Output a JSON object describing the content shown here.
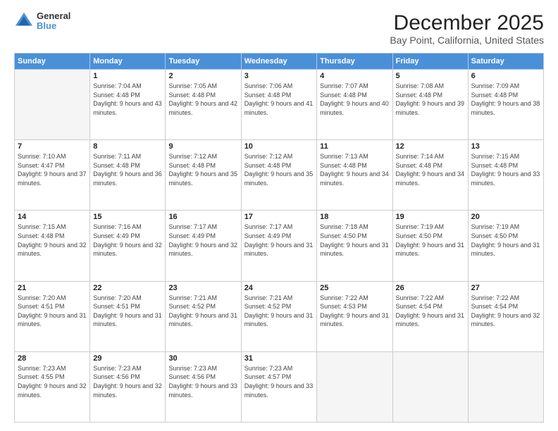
{
  "logo": {
    "general": "General",
    "blue": "Blue"
  },
  "header": {
    "title": "December 2025",
    "subtitle": "Bay Point, California, United States"
  },
  "calendar": {
    "weekdays": [
      "Sunday",
      "Monday",
      "Tuesday",
      "Wednesday",
      "Thursday",
      "Friday",
      "Saturday"
    ],
    "weeks": [
      [
        {
          "day": "",
          "empty": true
        },
        {
          "day": "1",
          "sunrise": "Sunrise: 7:04 AM",
          "sunset": "Sunset: 4:48 PM",
          "daylight": "Daylight: 9 hours and 43 minutes."
        },
        {
          "day": "2",
          "sunrise": "Sunrise: 7:05 AM",
          "sunset": "Sunset: 4:48 PM",
          "daylight": "Daylight: 9 hours and 42 minutes."
        },
        {
          "day": "3",
          "sunrise": "Sunrise: 7:06 AM",
          "sunset": "Sunset: 4:48 PM",
          "daylight": "Daylight: 9 hours and 41 minutes."
        },
        {
          "day": "4",
          "sunrise": "Sunrise: 7:07 AM",
          "sunset": "Sunset: 4:48 PM",
          "daylight": "Daylight: 9 hours and 40 minutes."
        },
        {
          "day": "5",
          "sunrise": "Sunrise: 7:08 AM",
          "sunset": "Sunset: 4:48 PM",
          "daylight": "Daylight: 9 hours and 39 minutes."
        },
        {
          "day": "6",
          "sunrise": "Sunrise: 7:09 AM",
          "sunset": "Sunset: 4:48 PM",
          "daylight": "Daylight: 9 hours and 38 minutes."
        }
      ],
      [
        {
          "day": "7",
          "sunrise": "Sunrise: 7:10 AM",
          "sunset": "Sunset: 4:47 PM",
          "daylight": "Daylight: 9 hours and 37 minutes."
        },
        {
          "day": "8",
          "sunrise": "Sunrise: 7:11 AM",
          "sunset": "Sunset: 4:48 PM",
          "daylight": "Daylight: 9 hours and 36 minutes."
        },
        {
          "day": "9",
          "sunrise": "Sunrise: 7:12 AM",
          "sunset": "Sunset: 4:48 PM",
          "daylight": "Daylight: 9 hours and 35 minutes."
        },
        {
          "day": "10",
          "sunrise": "Sunrise: 7:12 AM",
          "sunset": "Sunset: 4:48 PM",
          "daylight": "Daylight: 9 hours and 35 minutes."
        },
        {
          "day": "11",
          "sunrise": "Sunrise: 7:13 AM",
          "sunset": "Sunset: 4:48 PM",
          "daylight": "Daylight: 9 hours and 34 minutes."
        },
        {
          "day": "12",
          "sunrise": "Sunrise: 7:14 AM",
          "sunset": "Sunset: 4:48 PM",
          "daylight": "Daylight: 9 hours and 34 minutes."
        },
        {
          "day": "13",
          "sunrise": "Sunrise: 7:15 AM",
          "sunset": "Sunset: 4:48 PM",
          "daylight": "Daylight: 9 hours and 33 minutes."
        }
      ],
      [
        {
          "day": "14",
          "sunrise": "Sunrise: 7:15 AM",
          "sunset": "Sunset: 4:48 PM",
          "daylight": "Daylight: 9 hours and 32 minutes."
        },
        {
          "day": "15",
          "sunrise": "Sunrise: 7:16 AM",
          "sunset": "Sunset: 4:49 PM",
          "daylight": "Daylight: 9 hours and 32 minutes."
        },
        {
          "day": "16",
          "sunrise": "Sunrise: 7:17 AM",
          "sunset": "Sunset: 4:49 PM",
          "daylight": "Daylight: 9 hours and 32 minutes."
        },
        {
          "day": "17",
          "sunrise": "Sunrise: 7:17 AM",
          "sunset": "Sunset: 4:49 PM",
          "daylight": "Daylight: 9 hours and 31 minutes."
        },
        {
          "day": "18",
          "sunrise": "Sunrise: 7:18 AM",
          "sunset": "Sunset: 4:50 PM",
          "daylight": "Daylight: 9 hours and 31 minutes."
        },
        {
          "day": "19",
          "sunrise": "Sunrise: 7:19 AM",
          "sunset": "Sunset: 4:50 PM",
          "daylight": "Daylight: 9 hours and 31 minutes."
        },
        {
          "day": "20",
          "sunrise": "Sunrise: 7:19 AM",
          "sunset": "Sunset: 4:50 PM",
          "daylight": "Daylight: 9 hours and 31 minutes."
        }
      ],
      [
        {
          "day": "21",
          "sunrise": "Sunrise: 7:20 AM",
          "sunset": "Sunset: 4:51 PM",
          "daylight": "Daylight: 9 hours and 31 minutes."
        },
        {
          "day": "22",
          "sunrise": "Sunrise: 7:20 AM",
          "sunset": "Sunset: 4:51 PM",
          "daylight": "Daylight: 9 hours and 31 minutes."
        },
        {
          "day": "23",
          "sunrise": "Sunrise: 7:21 AM",
          "sunset": "Sunset: 4:52 PM",
          "daylight": "Daylight: 9 hours and 31 minutes."
        },
        {
          "day": "24",
          "sunrise": "Sunrise: 7:21 AM",
          "sunset": "Sunset: 4:52 PM",
          "daylight": "Daylight: 9 hours and 31 minutes."
        },
        {
          "day": "25",
          "sunrise": "Sunrise: 7:22 AM",
          "sunset": "Sunset: 4:53 PM",
          "daylight": "Daylight: 9 hours and 31 minutes."
        },
        {
          "day": "26",
          "sunrise": "Sunrise: 7:22 AM",
          "sunset": "Sunset: 4:54 PM",
          "daylight": "Daylight: 9 hours and 31 minutes."
        },
        {
          "day": "27",
          "sunrise": "Sunrise: 7:22 AM",
          "sunset": "Sunset: 4:54 PM",
          "daylight": "Daylight: 9 hours and 32 minutes."
        }
      ],
      [
        {
          "day": "28",
          "sunrise": "Sunrise: 7:23 AM",
          "sunset": "Sunset: 4:55 PM",
          "daylight": "Daylight: 9 hours and 32 minutes."
        },
        {
          "day": "29",
          "sunrise": "Sunrise: 7:23 AM",
          "sunset": "Sunset: 4:56 PM",
          "daylight": "Daylight: 9 hours and 32 minutes."
        },
        {
          "day": "30",
          "sunrise": "Sunrise: 7:23 AM",
          "sunset": "Sunset: 4:56 PM",
          "daylight": "Daylight: 9 hours and 33 minutes."
        },
        {
          "day": "31",
          "sunrise": "Sunrise: 7:23 AM",
          "sunset": "Sunset: 4:57 PM",
          "daylight": "Daylight: 9 hours and 33 minutes."
        },
        {
          "day": "",
          "empty": true
        },
        {
          "day": "",
          "empty": true
        },
        {
          "day": "",
          "empty": true
        }
      ]
    ]
  }
}
